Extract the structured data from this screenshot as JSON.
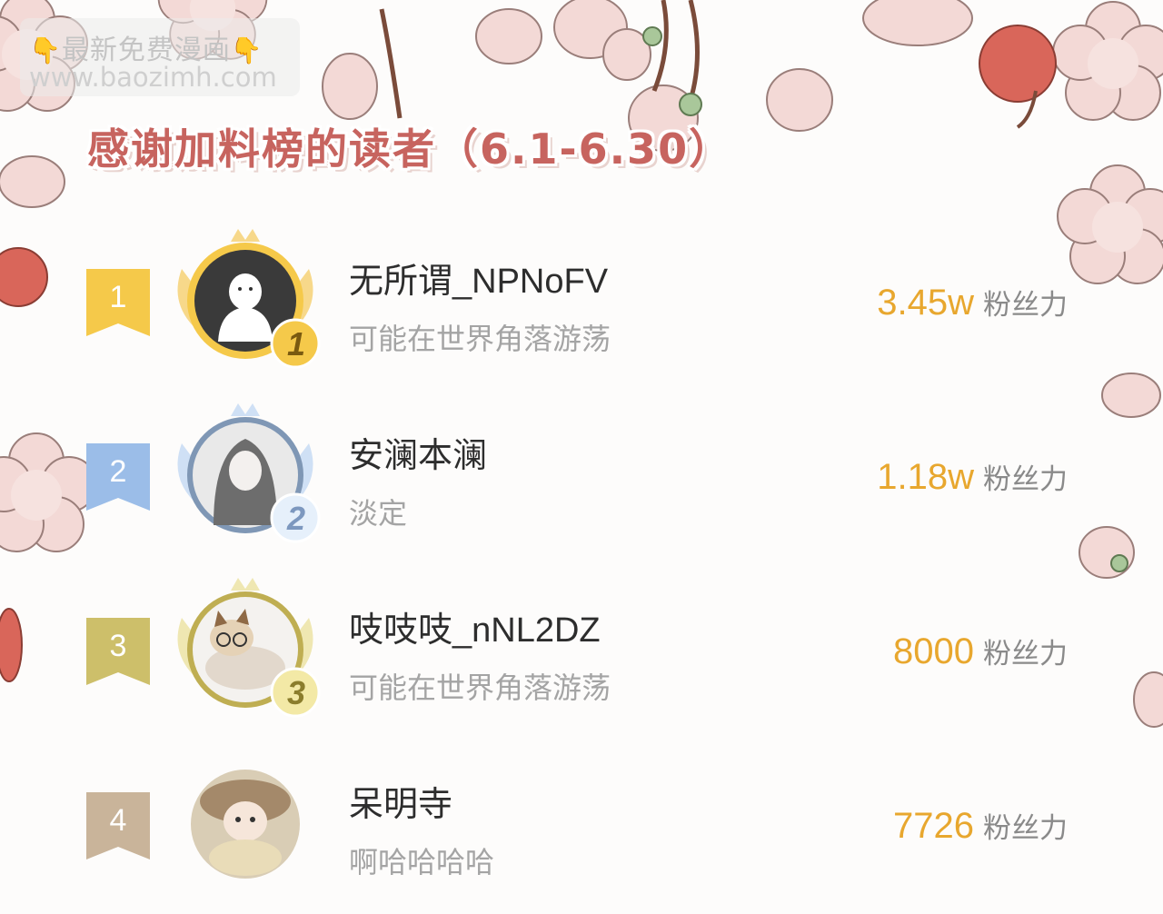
{
  "watermark": {
    "line1": "最新免费漫画",
    "line2": "www.baozimh.com",
    "hand_icon": "pointing-down-hand-icon"
  },
  "title": "感谢加料榜的读者（6.1-6.30）",
  "score_unit": "粉丝力",
  "colors": {
    "gold": "#f5c94a",
    "silver_blue": "#9bbde8",
    "bronze": "#cdbf6a",
    "plain": "#c9b49a",
    "score": "#e8a72e",
    "title": "#c7645f",
    "petal": "#f3d9d6",
    "cherry": "#d9665a"
  },
  "rows": [
    {
      "rank": "1",
      "name": "无所谓_NPNoFV",
      "motto": "可能在世界角落游荡",
      "score": "3.45w",
      "badge": "1",
      "avatar_icon": "ghost-figure-avatar-icon"
    },
    {
      "rank": "2",
      "name": "安澜本澜",
      "motto": "淡定",
      "score": "1.18w",
      "badge": "2",
      "avatar_icon": "anime-character-avatar-icon"
    },
    {
      "rank": "3",
      "name": "吱吱吱_nNL2DZ",
      "motto": "可能在世界角落游荡",
      "score": "8000",
      "badge": "3",
      "avatar_icon": "cat-with-glasses-avatar-icon"
    },
    {
      "rank": "4",
      "name": "呆明寺",
      "motto": "啊哈哈哈哈",
      "score": "7726",
      "badge": "",
      "avatar_icon": "plush-doll-avatar-icon"
    }
  ]
}
